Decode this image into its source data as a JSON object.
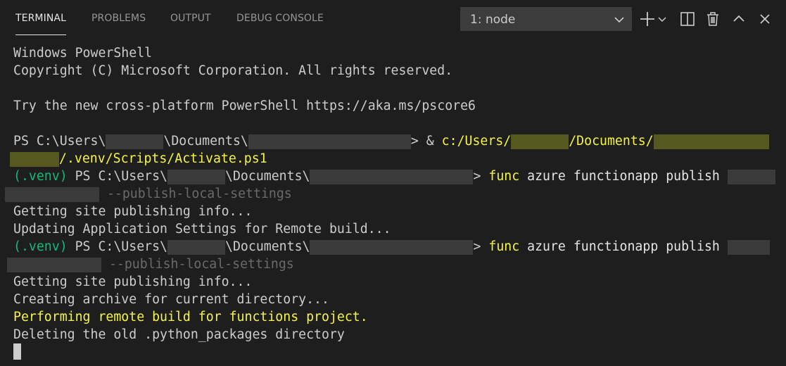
{
  "tabs": [
    "TERMINAL",
    "PROBLEMS",
    "OUTPUT",
    "DEBUG CONSOLE"
  ],
  "terminal_selector": {
    "selected": "1: node"
  },
  "toolbar_icons": [
    "plus-icon",
    "chevron-down-icon",
    "split-icon",
    "trash-icon",
    "chevron-up-icon",
    "close-icon"
  ],
  "lines": {
    "l1": "Windows PowerShell",
    "l2": "Copyright (C) Microsoft Corporation. All rights reserved.",
    "l4": "Try the new cross-platform PowerShell https://aka.ms/pscore6",
    "l6_a": "PS C:\\Users\\",
    "l6_b": "\\Documents\\",
    "l6_c": "> & ",
    "l6_d": "c:/Users/",
    "l6_e": "/Documents/",
    "l7": "/.venv/Scripts/Activate.ps1",
    "venv": "(.venv)",
    "ps_users": " PS C:\\Users\\",
    "documents": "\\Documents\\",
    "prompt_gt": "> ",
    "func": "func",
    "publish_cmd": " azure functionapp publish ",
    "local_settings": " --publish-local-settings",
    "getting_info": "Getting site publishing info...",
    "updating": "Updating Application Settings for Remote build...",
    "creating": "Creating archive for current directory...",
    "performing": "Performing remote build for functions project.",
    "deleting": "Deleting the old .python_packages directory"
  }
}
